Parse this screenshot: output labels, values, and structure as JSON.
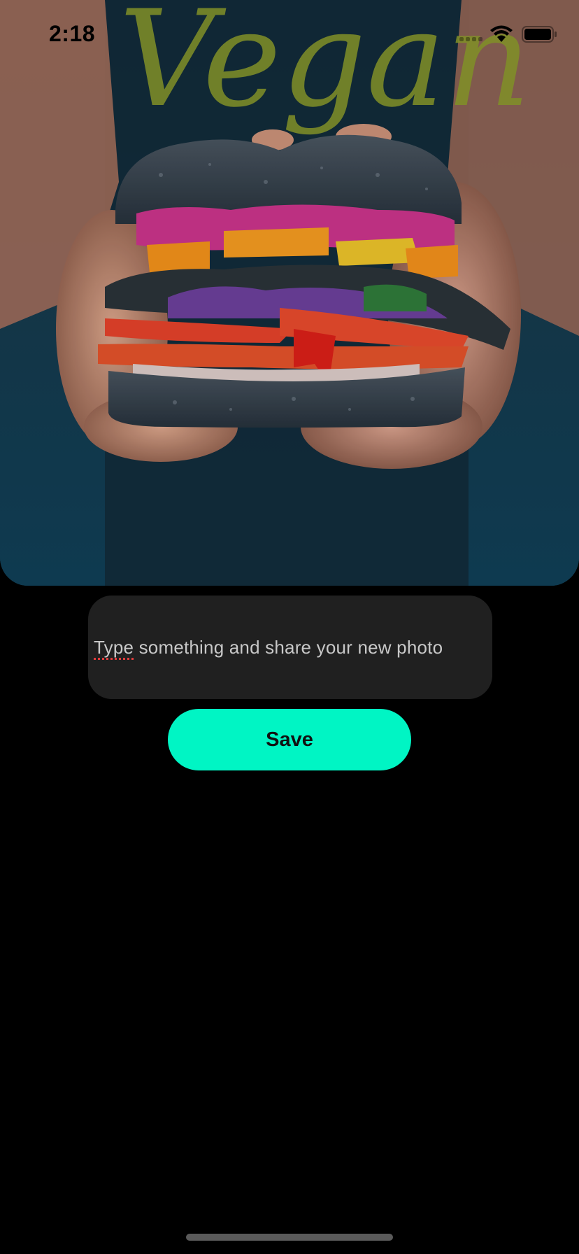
{
  "status_bar": {
    "time": "2:18",
    "icons": [
      "cellular-signal-icon",
      "wifi-icon",
      "battery-icon"
    ]
  },
  "photo": {
    "subject": "sandwich-photo",
    "shirt_text": "Vegan"
  },
  "caption": {
    "placeholder_first_word": "Type",
    "placeholder_rest": " something and share your new photo"
  },
  "actions": {
    "save_label": "Save"
  },
  "colors": {
    "background": "#000000",
    "input_background": "#202020",
    "accent": "#00f5c4",
    "placeholder_text": "#c8c8c8"
  }
}
